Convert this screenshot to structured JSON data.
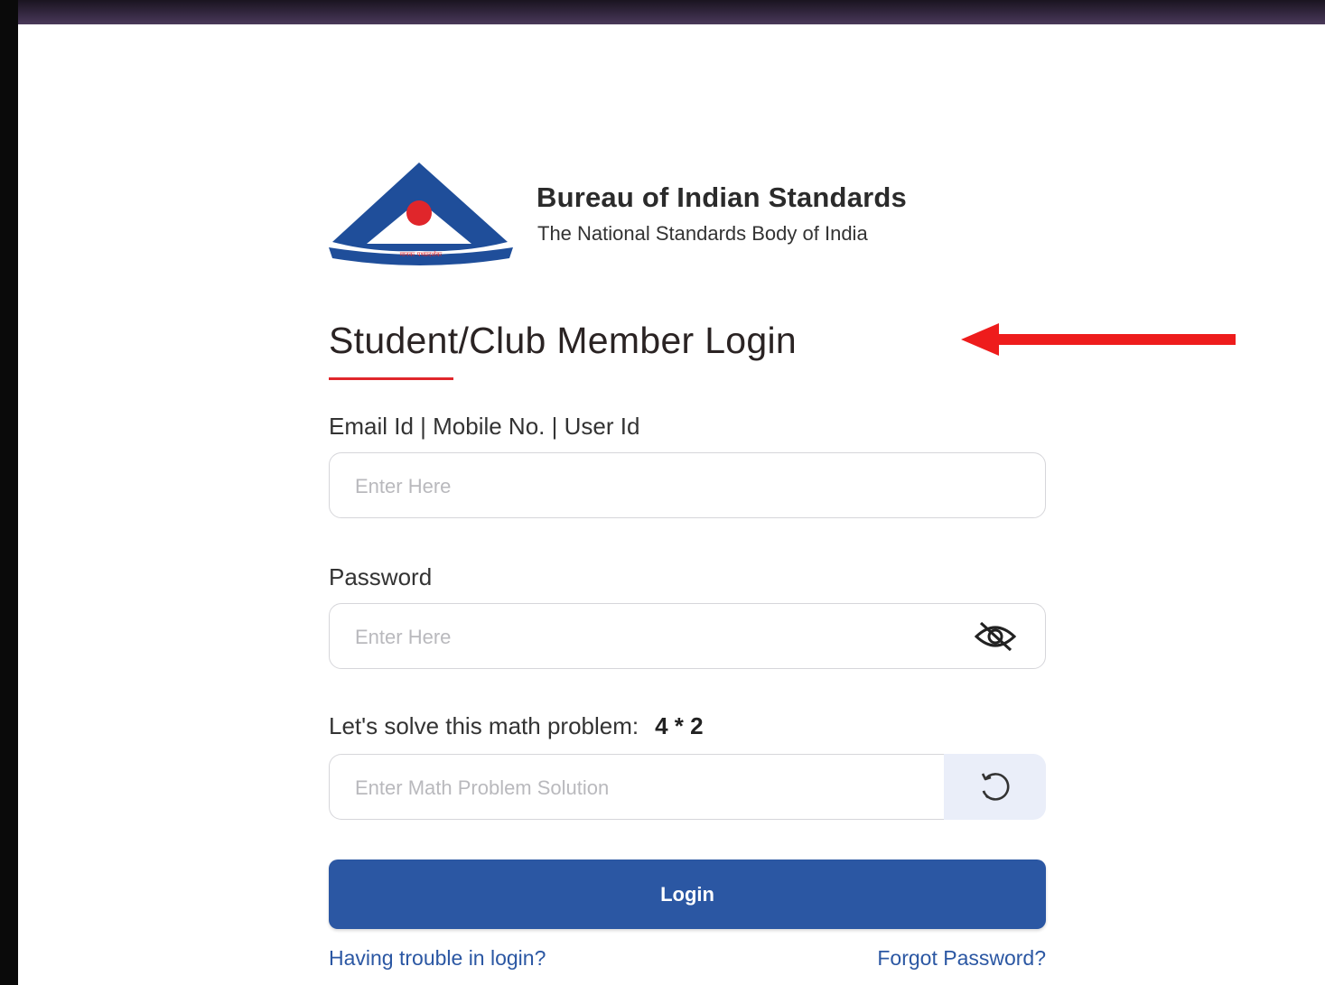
{
  "brand": {
    "name": "Bureau of Indian Standards",
    "tagline": "The National Standards Body of India",
    "logo_motto": "मानकः पथप्रदर्शकः",
    "primary_color": "#2b57a3",
    "accent_color": "#e0262b"
  },
  "login": {
    "title": "Student/Club Member Login",
    "email_label": "Email Id | Mobile No. | User Id",
    "email_placeholder": "Enter Here",
    "password_label": "Password",
    "password_placeholder": "Enter Here",
    "math_label": "Let's solve this math problem:",
    "math_expression": "4 * 2",
    "math_placeholder": "Enter Math Problem Solution",
    "submit_label": "Login",
    "trouble_link": "Having trouble in login?",
    "forgot_link": "Forgot Password?"
  },
  "icons": {
    "password_toggle": "eye-slash-icon",
    "captcha_refresh": "refresh-icon",
    "annotation": "red-arrow-icon"
  }
}
